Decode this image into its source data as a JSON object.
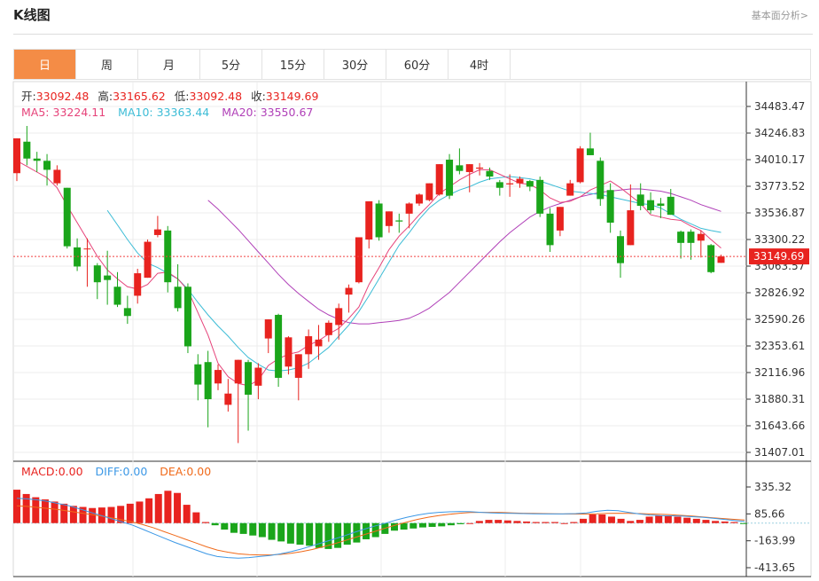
{
  "page": {
    "title": "K线图",
    "top_link": "基本面分析>"
  },
  "tabs": [
    {
      "label": "日",
      "active": true
    },
    {
      "label": "周",
      "active": false
    },
    {
      "label": "月",
      "active": false
    },
    {
      "label": "5分",
      "active": false
    },
    {
      "label": "15分",
      "active": false
    },
    {
      "label": "30分",
      "active": false
    },
    {
      "label": "60分",
      "active": false
    },
    {
      "label": "4时",
      "active": false
    }
  ],
  "ohlc_info": {
    "open_label": "开:",
    "open": "33092.48",
    "high_label": "高:",
    "high": "33165.62",
    "low_label": "低:",
    "low": "33092.48",
    "close_label": "收:",
    "close": "33149.69"
  },
  "ma_info": {
    "ma5_label": "MA5:",
    "ma5": "33224.11",
    "ma10_label": "MA10:",
    "ma10": "33363.44",
    "ma20_label": "MA20:",
    "ma20": "33550.67"
  },
  "macd_info": {
    "macd_label": "MACD:",
    "macd": "0.00",
    "diff_label": "DIFF:",
    "diff": "0.00",
    "dea_label": "DEA:",
    "dea": "0.00"
  },
  "colors": {
    "up": "#e8231f",
    "down": "#1aa51a",
    "ma5": "#e6437a",
    "ma10": "#3cbcd6",
    "ma20": "#b040b8",
    "dea": "#f06a1a",
    "diff": "#3c98e6",
    "accent": "#f48c46",
    "price_line": "#f24040"
  },
  "chart_data": {
    "type": "candlestick",
    "price_axis": {
      "ticks": [
        "34483.47",
        "34246.83",
        "34010.17",
        "33773.52",
        "33536.87",
        "33300.22",
        "33063.57",
        "32826.92",
        "32590.26",
        "32353.61",
        "32116.96",
        "31880.31",
        "31643.66",
        "31407.01"
      ],
      "range": [
        31407.01,
        34483.47
      ]
    },
    "current_price": "33149.69",
    "candles": [
      {
        "o": 33890,
        "h": 34160,
        "l": 33820,
        "c": 34200
      },
      {
        "o": 34170,
        "h": 34310,
        "l": 33960,
        "c": 34020
      },
      {
        "o": 34020,
        "h": 34080,
        "l": 33900,
        "c": 34000
      },
      {
        "o": 34000,
        "h": 34060,
        "l": 33780,
        "c": 33920
      },
      {
        "o": 33800,
        "h": 33960,
        "l": 33780,
        "c": 33920
      },
      {
        "o": 33760,
        "h": 33760,
        "l": 33220,
        "c": 33240
      },
      {
        "o": 33230,
        "h": 33310,
        "l": 33020,
        "c": 33060
      },
      {
        "o": 33220,
        "h": 33310,
        "l": 32880,
        "c": 33220
      },
      {
        "o": 33070,
        "h": 33090,
        "l": 32770,
        "c": 32920
      },
      {
        "o": 32980,
        "h": 33200,
        "l": 32720,
        "c": 32940
      },
      {
        "o": 32880,
        "h": 33010,
        "l": 32700,
        "c": 32720
      },
      {
        "o": 32690,
        "h": 32800,
        "l": 32550,
        "c": 32620
      },
      {
        "o": 32800,
        "h": 33040,
        "l": 32730,
        "c": 33000
      },
      {
        "o": 32960,
        "h": 33300,
        "l": 32960,
        "c": 33280
      },
      {
        "o": 33340,
        "h": 33510,
        "l": 33320,
        "c": 33390
      },
      {
        "o": 33380,
        "h": 33420,
        "l": 32830,
        "c": 32920
      },
      {
        "o": 32880,
        "h": 33080,
        "l": 32660,
        "c": 32690
      },
      {
        "o": 32880,
        "h": 32910,
        "l": 32290,
        "c": 32350
      },
      {
        "o": 32190,
        "h": 32280,
        "l": 31870,
        "c": 32010
      },
      {
        "o": 32210,
        "h": 32310,
        "l": 31630,
        "c": 31880
      },
      {
        "o": 32020,
        "h": 32190,
        "l": 31960,
        "c": 32140
      },
      {
        "o": 31830,
        "h": 32060,
        "l": 31770,
        "c": 31930
      },
      {
        "o": 32020,
        "h": 32230,
        "l": 31490,
        "c": 32230
      },
      {
        "o": 32210,
        "h": 32230,
        "l": 31600,
        "c": 31920
      },
      {
        "o": 32000,
        "h": 32200,
        "l": 31880,
        "c": 32160
      },
      {
        "o": 32420,
        "h": 32560,
        "l": 32290,
        "c": 32590
      },
      {
        "o": 32630,
        "h": 32640,
        "l": 31990,
        "c": 32070
      },
      {
        "o": 32170,
        "h": 32440,
        "l": 32100,
        "c": 32430
      },
      {
        "o": 32070,
        "h": 32270,
        "l": 31870,
        "c": 32280
      },
      {
        "o": 32280,
        "h": 32500,
        "l": 32150,
        "c": 32440
      },
      {
        "o": 32350,
        "h": 32540,
        "l": 32230,
        "c": 32410
      },
      {
        "o": 32450,
        "h": 32580,
        "l": 32390,
        "c": 32560
      },
      {
        "o": 32540,
        "h": 32730,
        "l": 32410,
        "c": 32690
      },
      {
        "o": 32810,
        "h": 32900,
        "l": 32650,
        "c": 32870
      },
      {
        "o": 32920,
        "h": 33320,
        "l": 32910,
        "c": 33320
      },
      {
        "o": 33300,
        "h": 33640,
        "l": 33220,
        "c": 33640
      },
      {
        "o": 33620,
        "h": 33650,
        "l": 33290,
        "c": 33320
      },
      {
        "o": 33420,
        "h": 33550,
        "l": 33360,
        "c": 33550
      },
      {
        "o": 33470,
        "h": 33530,
        "l": 33360,
        "c": 33460
      },
      {
        "o": 33530,
        "h": 33630,
        "l": 33400,
        "c": 33620
      },
      {
        "o": 33620,
        "h": 33710,
        "l": 33600,
        "c": 33700
      },
      {
        "o": 33650,
        "h": 33800,
        "l": 33640,
        "c": 33800
      },
      {
        "o": 33700,
        "h": 33960,
        "l": 33690,
        "c": 33970
      },
      {
        "o": 34010,
        "h": 34060,
        "l": 33660,
        "c": 33690
      },
      {
        "o": 33960,
        "h": 34110,
        "l": 33880,
        "c": 33910
      },
      {
        "o": 33900,
        "h": 33970,
        "l": 33720,
        "c": 33970
      },
      {
        "o": 33930,
        "h": 33980,
        "l": 33870,
        "c": 33940
      },
      {
        "o": 33910,
        "h": 33940,
        "l": 33830,
        "c": 33860
      },
      {
        "o": 33810,
        "h": 33830,
        "l": 33690,
        "c": 33760
      },
      {
        "o": 33790,
        "h": 33880,
        "l": 33680,
        "c": 33800
      },
      {
        "o": 33800,
        "h": 33860,
        "l": 33760,
        "c": 33840
      },
      {
        "o": 33820,
        "h": 33830,
        "l": 33730,
        "c": 33770
      },
      {
        "o": 33830,
        "h": 33860,
        "l": 33500,
        "c": 33530
      },
      {
        "o": 33530,
        "h": 33580,
        "l": 33190,
        "c": 33250
      },
      {
        "o": 33380,
        "h": 33590,
        "l": 33330,
        "c": 33590
      },
      {
        "o": 33690,
        "h": 33830,
        "l": 33690,
        "c": 33800
      },
      {
        "o": 33810,
        "h": 34130,
        "l": 33800,
        "c": 34110
      },
      {
        "o": 34110,
        "h": 34250,
        "l": 34090,
        "c": 34050
      },
      {
        "o": 34000,
        "h": 34030,
        "l": 33600,
        "c": 33660
      },
      {
        "o": 33740,
        "h": 33800,
        "l": 33360,
        "c": 33450
      },
      {
        "o": 33330,
        "h": 33380,
        "l": 32960,
        "c": 33090
      },
      {
        "o": 33250,
        "h": 33790,
        "l": 33250,
        "c": 33560
      },
      {
        "o": 33700,
        "h": 33800,
        "l": 33560,
        "c": 33600
      },
      {
        "o": 33650,
        "h": 33720,
        "l": 33530,
        "c": 33560
      },
      {
        "o": 33620,
        "h": 33670,
        "l": 33490,
        "c": 33600
      },
      {
        "o": 33680,
        "h": 33750,
        "l": 33580,
        "c": 33520
      },
      {
        "o": 33370,
        "h": 33380,
        "l": 33130,
        "c": 33270
      },
      {
        "o": 33370,
        "h": 33390,
        "l": 33120,
        "c": 33270
      },
      {
        "o": 33290,
        "h": 33380,
        "l": 33140,
        "c": 33350
      },
      {
        "o": 33250,
        "h": 33260,
        "l": 33000,
        "c": 33010
      },
      {
        "o": 33092.48,
        "h": 33165.62,
        "l": 33092.48,
        "c": 33149.69
      }
    ],
    "ma5": [
      34000,
      33950,
      33900,
      33850,
      33760,
      33600,
      33450,
      33300,
      33150,
      33030,
      32950,
      32880,
      32860,
      32900,
      33000,
      33010,
      32950,
      32850,
      32650,
      32450,
      32200,
      32080,
      32020,
      32000,
      32050,
      32180,
      32240,
      32280,
      32300,
      32360,
      32400,
      32460,
      32510,
      32600,
      32700,
      32900,
      33050,
      33210,
      33330,
      33420,
      33520,
      33610,
      33710,
      33770,
      33830,
      33880,
      33920,
      33920,
      33880,
      33840,
      33800,
      33790,
      33740,
      33670,
      33630,
      33640,
      33680,
      33740,
      33780,
      33820,
      33760,
      33690,
      33620,
      33520,
      33500,
      33480,
      33470,
      33420,
      33380,
      33300,
      33224.11
    ],
    "ma10": [
      null,
      null,
      null,
      null,
      null,
      null,
      null,
      null,
      null,
      33560,
      33430,
      33300,
      33180,
      33090,
      33050,
      33000,
      32950,
      32860,
      32740,
      32630,
      32530,
      32440,
      32340,
      32250,
      32190,
      32140,
      32130,
      32140,
      32160,
      32200,
      32270,
      32340,
      32440,
      32540,
      32660,
      32800,
      32950,
      33100,
      33250,
      33360,
      33480,
      33580,
      33650,
      33700,
      33740,
      33770,
      33810,
      33840,
      33850,
      33860,
      33850,
      33840,
      33820,
      33790,
      33760,
      33730,
      33720,
      33710,
      33700,
      33680,
      33660,
      33640,
      33620,
      33610,
      33580,
      33530,
      33480,
      33440,
      33400,
      33380,
      33363.44
    ],
    "ma20": [
      null,
      null,
      null,
      null,
      null,
      null,
      null,
      null,
      null,
      null,
      null,
      null,
      null,
      null,
      null,
      null,
      null,
      null,
      null,
      33650,
      33570,
      33480,
      33390,
      33290,
      33190,
      33090,
      32990,
      32900,
      32820,
      32750,
      32680,
      32630,
      32590,
      32560,
      32550,
      32550,
      32560,
      32570,
      32580,
      32600,
      32640,
      32690,
      32760,
      32830,
      32920,
      33010,
      33100,
      33190,
      33280,
      33360,
      33430,
      33500,
      33550,
      33590,
      33620,
      33650,
      33680,
      33700,
      33720,
      33730,
      33740,
      33750,
      33750,
      33740,
      33730,
      33710,
      33680,
      33650,
      33610,
      33580,
      33550.67
    ],
    "macd_axis": {
      "ticks": [
        "335.32",
        "85.66",
        "-163.99",
        "-413.65"
      ],
      "range": [
        -413.65,
        335.32
      ]
    },
    "macd_bars": [
      310,
      270,
      240,
      220,
      200,
      180,
      160,
      150,
      140,
      145,
      150,
      160,
      180,
      200,
      230,
      270,
      300,
      280,
      170,
      100,
      10,
      -20,
      -60,
      -90,
      -100,
      -115,
      -130,
      -155,
      -170,
      -190,
      -200,
      -210,
      -230,
      -240,
      -230,
      -200,
      -180,
      -150,
      -130,
      -100,
      -70,
      -60,
      -50,
      -40,
      -35,
      -30,
      -20,
      -10,
      0,
      20,
      30,
      30,
      25,
      20,
      15,
      10,
      10,
      10,
      0,
      10,
      40,
      80,
      80,
      60,
      40,
      20,
      30,
      60,
      70,
      65,
      60,
      50,
      40,
      30,
      20,
      15,
      10,
      -5
    ],
    "macd_diff": [
      230,
      225,
      215,
      200,
      180,
      160,
      130,
      100,
      70,
      40,
      10,
      -20,
      -60,
      -100,
      -140,
      -180,
      -215,
      -250,
      -285,
      -310,
      -320,
      -325,
      -320,
      -310,
      -300,
      -285,
      -265,
      -240,
      -210,
      -180,
      -150,
      -120,
      -85,
      -55,
      -25,
      0,
      30,
      55,
      75,
      90,
      100,
      105,
      108,
      106,
      100,
      95,
      92,
      90,
      88,
      86,
      85,
      85,
      86,
      88,
      95,
      110,
      120,
      115,
      100,
      85,
      75,
      70,
      68,
      65,
      60,
      55,
      45,
      35,
      25,
      15
    ],
    "macd_dea": [
      160,
      155,
      145,
      135,
      125,
      110,
      95,
      80,
      65,
      50,
      30,
      10,
      -15,
      -45,
      -80,
      -115,
      -150,
      -185,
      -220,
      -250,
      -270,
      -285,
      -292,
      -295,
      -295,
      -290,
      -280,
      -265,
      -245,
      -220,
      -195,
      -165,
      -135,
      -105,
      -75,
      -45,
      -15,
      10,
      35,
      55,
      70,
      82,
      92,
      98,
      100,
      100,
      98,
      95,
      92,
      90,
      88,
      86,
      85,
      84,
      84,
      86,
      90,
      92,
      90,
      88,
      85,
      82,
      78,
      72,
      65,
      58,
      50,
      42,
      35,
      28
    ],
    "grid": true,
    "legend_placement": "top-left"
  }
}
